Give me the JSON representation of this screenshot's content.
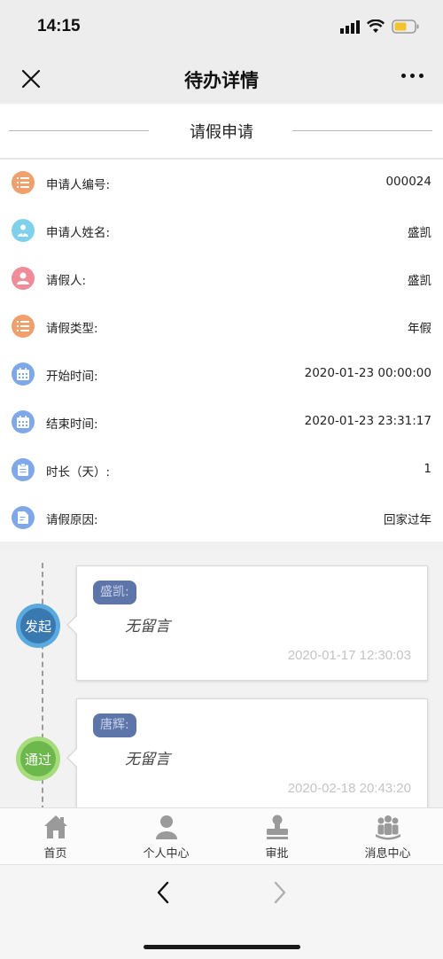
{
  "status_bar": {
    "time": "14:15"
  },
  "nav": {
    "title": "待办详情"
  },
  "form": {
    "title": "请假申请",
    "fields": [
      {
        "label": "申请人编号:",
        "value": "000024",
        "icon": "list-icon",
        "color": "#f0a06c"
      },
      {
        "label": "申请人姓名:",
        "value": "盛凯",
        "icon": "users-icon",
        "color": "#7fd0ea"
      },
      {
        "label": "请假人:",
        "value": "盛凯",
        "icon": "user-icon",
        "color": "#f08c9a"
      },
      {
        "label": "请假类型:",
        "value": "年假",
        "icon": "list-icon",
        "color": "#f0a06c"
      },
      {
        "label": "开始时间:",
        "value": "2020-01-23 00:00:00",
        "icon": "calendar-icon",
        "color": "#7fa8ea"
      },
      {
        "label": "结束时间:",
        "value": "2020-01-23 23:31:17",
        "icon": "calendar-icon",
        "color": "#7fa8ea"
      },
      {
        "label": "时长（天）:",
        "value": "1",
        "icon": "clipboard-icon",
        "color": "#7fa8ea"
      },
      {
        "label": "请假原因:",
        "value": "回家过年",
        "icon": "document-icon",
        "color": "#7fa8ea"
      }
    ]
  },
  "timeline": [
    {
      "node_label": "发起",
      "node_color": "#3a78b0",
      "ring_color": "#5aaae0",
      "name": "盛凯:",
      "message": "无留言",
      "time": "2020-01-17 12:30:03"
    },
    {
      "node_label": "通过",
      "node_color": "#6cb84c",
      "ring_color": "#a6dc7c",
      "name": "唐辉:",
      "message": "无留言",
      "time": "2020-02-18 20:43:20"
    }
  ],
  "tabs": [
    {
      "label": "首页",
      "icon": "home-icon"
    },
    {
      "label": "个人中心",
      "icon": "person-icon"
    },
    {
      "label": "审批",
      "icon": "stamp-icon"
    },
    {
      "label": "消息中心",
      "icon": "group-icon"
    }
  ]
}
